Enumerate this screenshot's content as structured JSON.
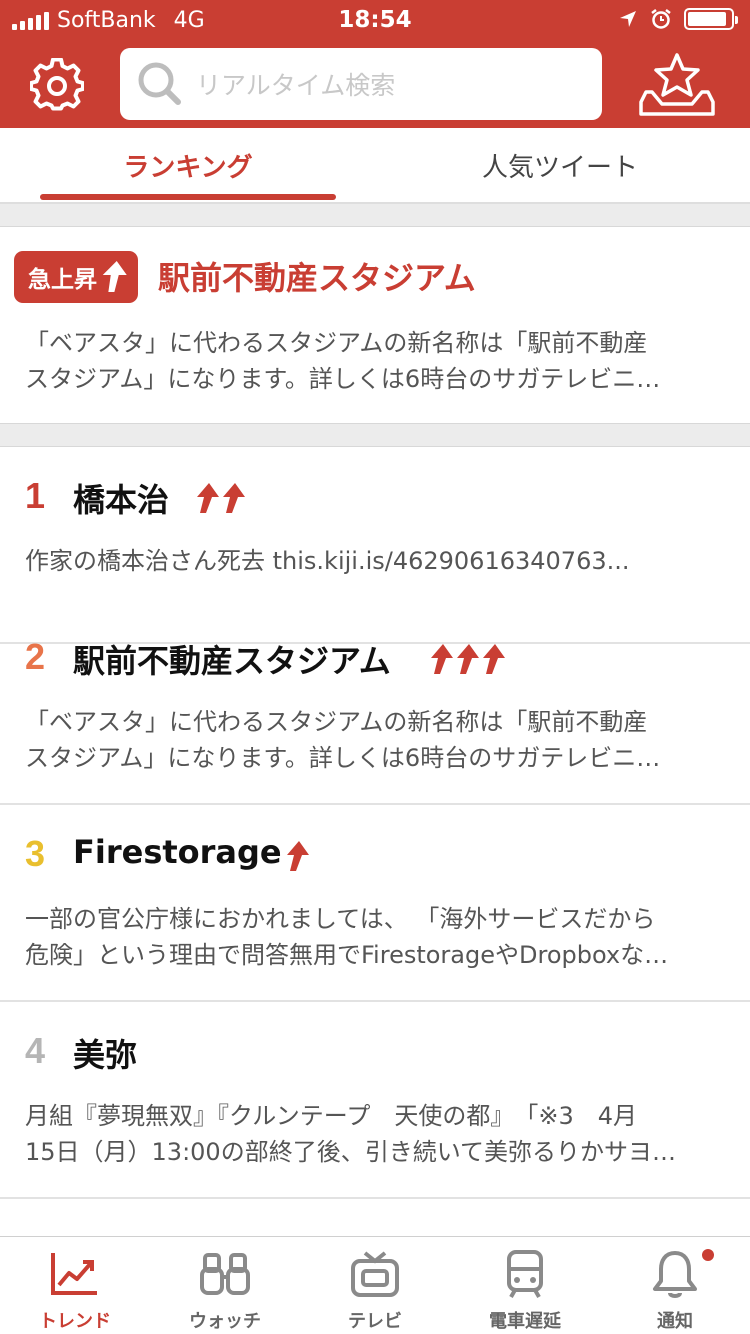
{
  "status": {
    "carrier": "SoftBank",
    "network": "4G",
    "time": "18:54"
  },
  "header": {
    "search_placeholder": "リアルタイム検索",
    "settings_icon": "gear-icon",
    "favorites_icon": "star-tray-icon"
  },
  "tabs": [
    {
      "label": "ランキング",
      "active": true
    },
    {
      "label": "人気ツイート",
      "active": false
    }
  ],
  "featured": {
    "badge": "急上昇",
    "title": "駅前不動産スタジアム",
    "desc_line1": "「ベアスタ」に代わるスタジアムの新名称は「駅前不動産",
    "desc_line2": "スタジアム」になります。詳しくは6時台のサガテレビニ…"
  },
  "ranking": [
    {
      "rank": "1",
      "rank_color": "#c93e33",
      "name": "橋本治",
      "arrows": 2,
      "desc_line1": "作家の橋本治さん死去 this.kiji.is/46290616340763...",
      "desc_line2": ""
    },
    {
      "rank": "2",
      "rank_color": "#e8744a",
      "name": "駅前不動産スタジアム",
      "arrows": 3,
      "desc_line1": "「ベアスタ」に代わるスタジアムの新名称は「駅前不動産",
      "desc_line2": "スタジアム」になります。詳しくは6時台のサガテレビニ…"
    },
    {
      "rank": "3",
      "rank_color": "#e9bf2e",
      "name": "Firestorage",
      "arrows": 1,
      "desc_line1": "一部の官公庁様におかれましては、 「海外サービスだから",
      "desc_line2": "危険」という理由で問答無用でFirestorageやDropboxな…"
    },
    {
      "rank": "4",
      "rank_color": "#b5b5b5",
      "name": "美弥",
      "arrows": 0,
      "desc_line1": "月組『夢現無双』『クルンテープ　天使の都』　「※3　4月",
      "desc_line2": "15日（月）13:00の部終了後、引き続いて美弥るりかサヨ…"
    }
  ],
  "bottom_nav": [
    {
      "label": "トレンド",
      "icon": "trend-chart-icon",
      "active": true
    },
    {
      "label": "ウォッチ",
      "icon": "binoculars-icon",
      "active": false
    },
    {
      "label": "テレビ",
      "icon": "tv-icon",
      "active": false
    },
    {
      "label": "電車遅延",
      "icon": "train-icon",
      "active": false
    },
    {
      "label": "通知",
      "icon": "bell-icon",
      "active": false,
      "has_badge": true
    }
  ],
  "colors": {
    "brand": "#c93e33"
  }
}
